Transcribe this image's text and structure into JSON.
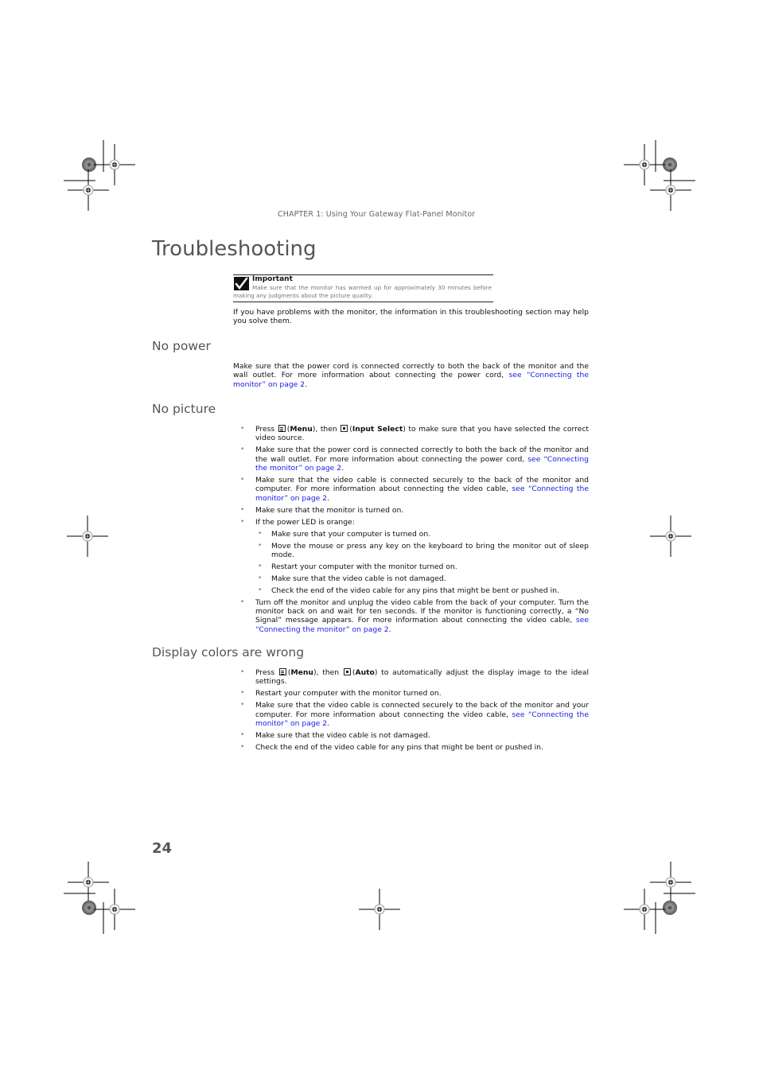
{
  "running_header": "CHAPTER 1: Using Your Gateway Flat-Panel Monitor",
  "page_title": "Troubleshooting",
  "important_note": {
    "icon": "checkmark-icon",
    "label": "Important",
    "text": "Make sure that the monitor has warmed up for approximately 30 minutes before making any judgments about the picture quality."
  },
  "intro": "If you have problems with the monitor, the information in this troubleshooting section may help you solve them.",
  "sections": {
    "no_power": {
      "heading": "No power",
      "text": "Make sure that the power cord is connected correctly to both the back of the monitor and the wall outlet. For more information about connecting the power cord, ",
      "link": "see “Connecting the monitor” on page 2",
      "after": "."
    },
    "no_picture": {
      "heading": "No picture",
      "items": [
        {
          "pre": "Press ",
          "icon1": "menu-button-icon",
          "b1": "Menu",
          "mid": "), then ",
          "icon2": "select-button-icon",
          "b2": "Input Select",
          "post": ") to make sure that you have selected the correct video source."
        },
        {
          "text": "Make sure that the power cord is connected correctly to both the back of the monitor and the wall outlet. For more information about connecting the power cord, ",
          "link": "see “Connecting the monitor” on page 2",
          "after": "."
        },
        {
          "text": "Make sure that the video cable is connected securely to the back of the monitor and computer. For more information about connecting the video cable, ",
          "link": "see “Connecting the monitor” on page 2",
          "after": "."
        },
        {
          "text": "Make sure that the monitor is turned on."
        },
        {
          "text": "If the power LED is orange:",
          "sub": [
            "Make sure that your computer is turned on.",
            "Move the mouse or press any key on the keyboard to bring the monitor out of sleep mode.",
            "Restart your computer with the monitor turned on.",
            "Make sure that the video cable is not damaged.",
            "Check the end of the video cable for any pins that might be bent or pushed in."
          ]
        },
        {
          "text": "Turn off the monitor and unplug the video cable from the back of your computer. Turn the monitor back on and wait for ten seconds. If the monitor is functioning correctly, a “No Signal” message appears. For more information about connecting the video cable, ",
          "link": "see “Connecting the monitor” on page 2",
          "after": "."
        }
      ]
    },
    "display_colors": {
      "heading": "Display colors are wrong",
      "items": [
        {
          "pre": "Press ",
          "b1": "Menu",
          "mid": "), then ",
          "b2": "Auto",
          "post": ") to automatically adjust the display image to the ideal settings."
        },
        {
          "text": "Restart your computer with the monitor turned on."
        },
        {
          "text": "Make sure that the video cable is connected securely to the back of the monitor and your computer. For more information about connecting the video cable, ",
          "link": "see “Connecting the monitor” on page 2",
          "after": "."
        },
        {
          "text": "Make sure that the video cable is not damaged."
        },
        {
          "text": "Check the end of the video cable for any pins that might be bent or pushed in."
        }
      ]
    }
  },
  "bullet_glyph": "•",
  "open_paren": "(",
  "page_number": "24",
  "colors": {
    "link": "#1a1ae6",
    "heading": "#555555",
    "note_text": "#777777"
  }
}
